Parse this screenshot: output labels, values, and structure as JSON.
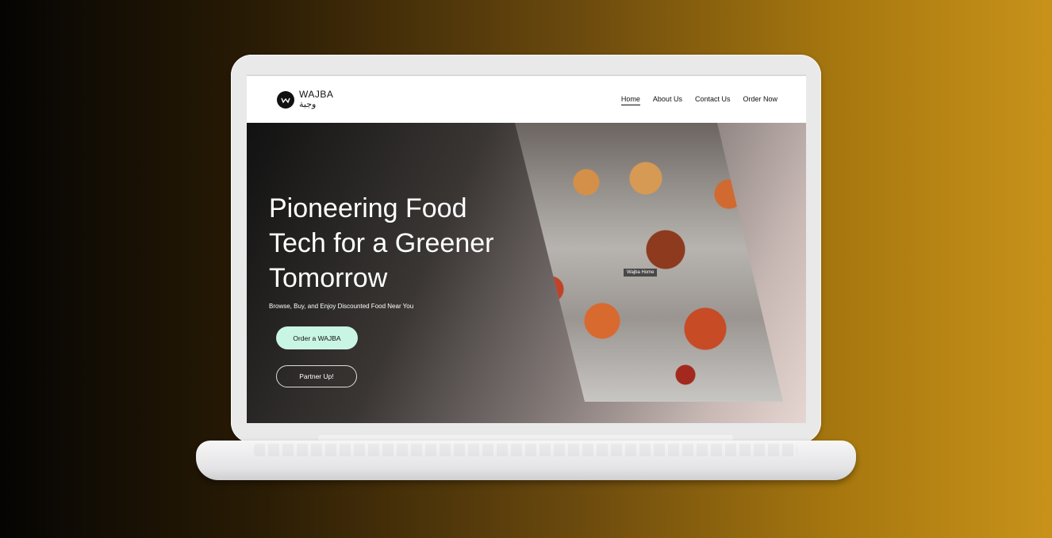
{
  "brand": {
    "name": "WAJBA",
    "arabic": "وجبة",
    "logo_icon": "wajba-logo-icon"
  },
  "nav": {
    "items": [
      {
        "label": "Home",
        "active": true
      },
      {
        "label": "About Us",
        "active": false
      },
      {
        "label": "Contact Us",
        "active": false
      },
      {
        "label": "Order Now",
        "active": false
      }
    ]
  },
  "hero": {
    "title": "Pioneering Food Tech for a Greener Tomorrow",
    "subtitle": "Browse, Buy, and Enjoy Discounted Food Near You",
    "primary_button": "Order a WAJBA",
    "secondary_button": "Partner Up!",
    "image_caption": "Wajba Home"
  },
  "colors": {
    "primary_button_bg": "#c9f5e4",
    "background_gradient_start": "#050403",
    "background_gradient_end": "#c8921a"
  }
}
